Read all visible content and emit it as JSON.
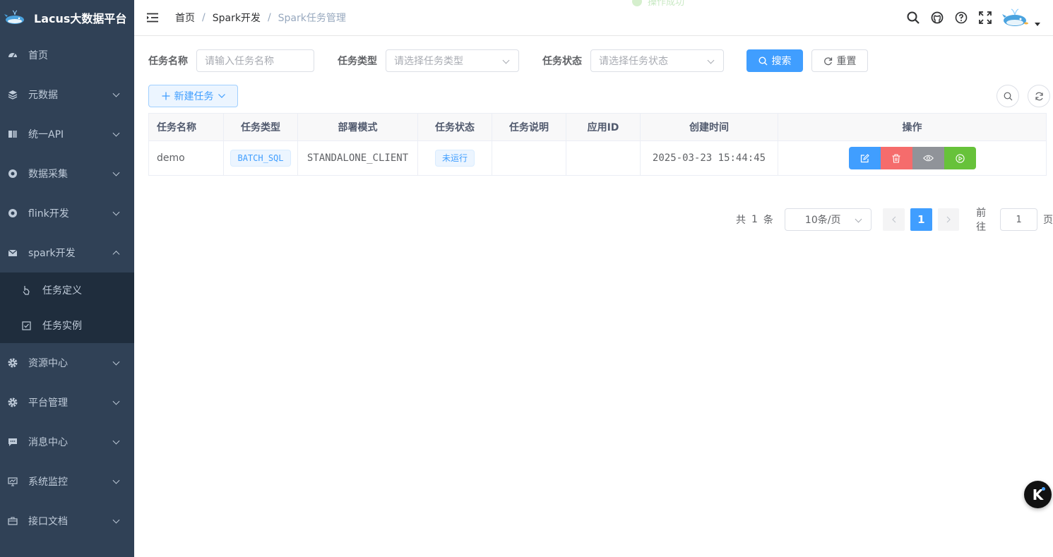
{
  "app": {
    "title": "Lacus大数据平台"
  },
  "toast": {
    "text": "操作成功"
  },
  "sidebar": {
    "items": [
      {
        "label": "首页",
        "icon": "dashboard-icon"
      },
      {
        "label": "元数据",
        "icon": "layers-icon"
      },
      {
        "label": "统一API",
        "icon": "book-icon"
      },
      {
        "label": "数据采集",
        "icon": "target-icon"
      },
      {
        "label": "flink开发",
        "icon": "target-icon"
      },
      {
        "label": "spark开发",
        "icon": "mail-icon"
      },
      {
        "label": "资源中心",
        "icon": "gear-icon"
      },
      {
        "label": "平台管理",
        "icon": "gear-icon"
      },
      {
        "label": "消息中心",
        "icon": "chat-icon"
      },
      {
        "label": "系统监控",
        "icon": "monitor-icon"
      },
      {
        "label": "接口文档",
        "icon": "briefcase-icon"
      }
    ],
    "submenu": [
      {
        "label": "任务定义",
        "icon": "hand-pointer-icon"
      },
      {
        "label": "任务实例",
        "icon": "checkbox-icon"
      }
    ]
  },
  "breadcrumb": {
    "home": "首页",
    "parent": "Spark开发",
    "current": "Spark任务管理",
    "separator": "/"
  },
  "search": {
    "name_label": "任务名称",
    "name_placeholder": "请输入任务名称",
    "type_label": "任务类型",
    "type_placeholder": "请选择任务类型",
    "status_label": "任务状态",
    "status_placeholder": "请选择任务状态",
    "search_button": "搜索",
    "reset_button": "重置"
  },
  "toolbar": {
    "new_task": "新建任务"
  },
  "table": {
    "columns": [
      "任务名称",
      "任务类型",
      "部署模式",
      "任务状态",
      "任务说明",
      "应用ID",
      "创建时间",
      "操作"
    ],
    "rows": [
      {
        "name": "demo",
        "type": "BATCH_SQL",
        "deploy_mode": "STANDALONE_CLIENT",
        "status": "未运行",
        "description": "",
        "app_id": "",
        "created": "2025-03-23 15:44:45"
      }
    ]
  },
  "pagination": {
    "total_prefix": "共",
    "total": "1",
    "total_suffix": "条",
    "page_size": "10条/页",
    "current_page": "1",
    "goto_label": "前往",
    "goto_value": "1",
    "goto_suffix": "页"
  },
  "colors": {
    "sidebar_bg": "#304156",
    "submenu_bg": "#1f2d3d",
    "primary": "#409eff",
    "danger": "#f56c6c",
    "info": "#909399",
    "success": "#67c23a"
  }
}
